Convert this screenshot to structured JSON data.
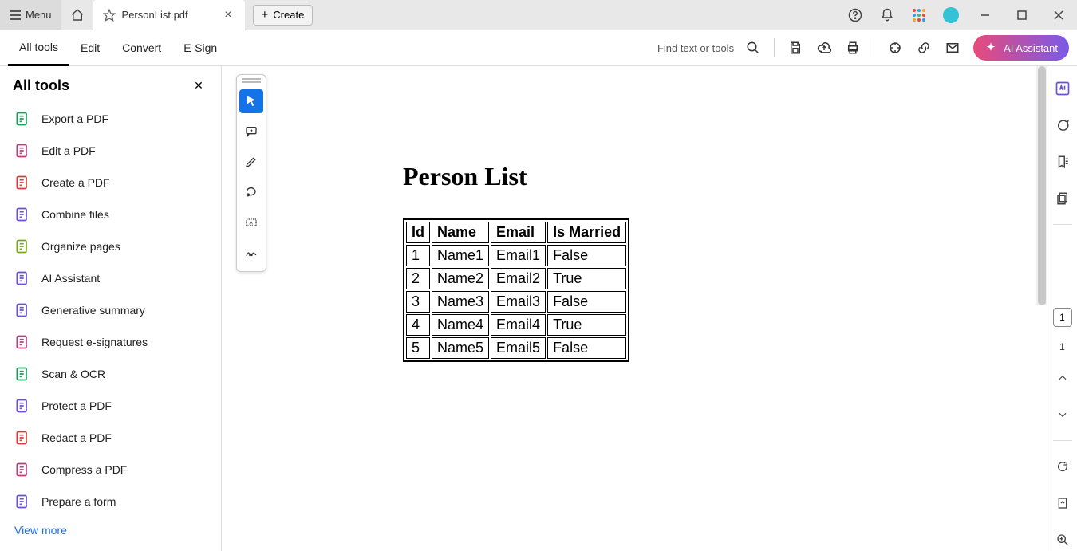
{
  "titlebar": {
    "menu_label": "Menu",
    "tab_title": "PersonList.pdf",
    "create_label": "Create"
  },
  "toolbar2": {
    "tabs": [
      "All tools",
      "Edit",
      "Convert",
      "E-Sign"
    ],
    "find_label": "Find text or tools",
    "ai_label": "AI Assistant"
  },
  "sidebar": {
    "title": "All tools",
    "items": [
      "Export a PDF",
      "Edit a PDF",
      "Create a PDF",
      "Combine files",
      "Organize pages",
      "AI Assistant",
      "Generative summary",
      "Request e-signatures",
      "Scan & OCR",
      "Protect a PDF",
      "Redact a PDF",
      "Compress a PDF",
      "Prepare a form"
    ],
    "view_more": "View more"
  },
  "document": {
    "title": "Person List",
    "columns": [
      "Id",
      "Name",
      "Email",
      "Is Married"
    ],
    "rows": [
      {
        "id": "1",
        "name": "Name1",
        "email": "Email1",
        "married": "False"
      },
      {
        "id": "2",
        "name": "Name2",
        "email": "Email2",
        "married": "True"
      },
      {
        "id": "3",
        "name": "Name3",
        "email": "Email3",
        "married": "False"
      },
      {
        "id": "4",
        "name": "Name4",
        "email": "Email4",
        "married": "True"
      },
      {
        "id": "5",
        "name": "Name5",
        "email": "Email5",
        "married": "False"
      }
    ]
  },
  "paging": {
    "current": "1",
    "total": "1"
  },
  "colors": {
    "accent_blue": "#1473e6",
    "ai_gradient_start": "#e84a7a",
    "ai_gradient_end": "#7a5ae8"
  },
  "sidebar_icon_colors": [
    "#1a9c5a",
    "#b0407a",
    "#d43b3b",
    "#6a4fd6",
    "#7aa61a",
    "#6a4fd6",
    "#6a4fd6",
    "#b0407a",
    "#1a9c5a",
    "#6a4fd6",
    "#d43b3b",
    "#b0407a",
    "#6a4fd6"
  ]
}
